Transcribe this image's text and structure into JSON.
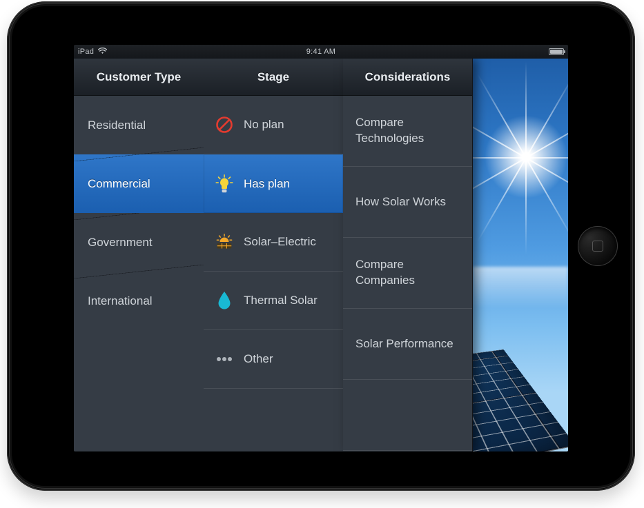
{
  "status_bar": {
    "device": "iPad",
    "time": "9:41 AM"
  },
  "columns": {
    "customer_type": {
      "header": "Customer Type",
      "selected_index": 1,
      "items": [
        {
          "label": "Residential"
        },
        {
          "label": "Commercial"
        },
        {
          "label": "Government"
        },
        {
          "label": "International"
        }
      ]
    },
    "stage": {
      "header": "Stage",
      "selected_index": 1,
      "items": [
        {
          "label": "No plan",
          "icon": "no-plan-icon"
        },
        {
          "label": "Has plan",
          "icon": "lightbulb-icon"
        },
        {
          "label": "Solar–Electric",
          "icon": "solar-electric-icon"
        },
        {
          "label": "Thermal Solar",
          "icon": "water-drop-icon"
        },
        {
          "label": "Other",
          "icon": "ellipsis-icon"
        }
      ]
    },
    "considerations": {
      "header": "Considerations",
      "items": [
        {
          "label": "Compare Technologies"
        },
        {
          "label": "How Solar Works"
        },
        {
          "label": "Compare Companies"
        },
        {
          "label": "Solar Performance"
        }
      ]
    }
  }
}
